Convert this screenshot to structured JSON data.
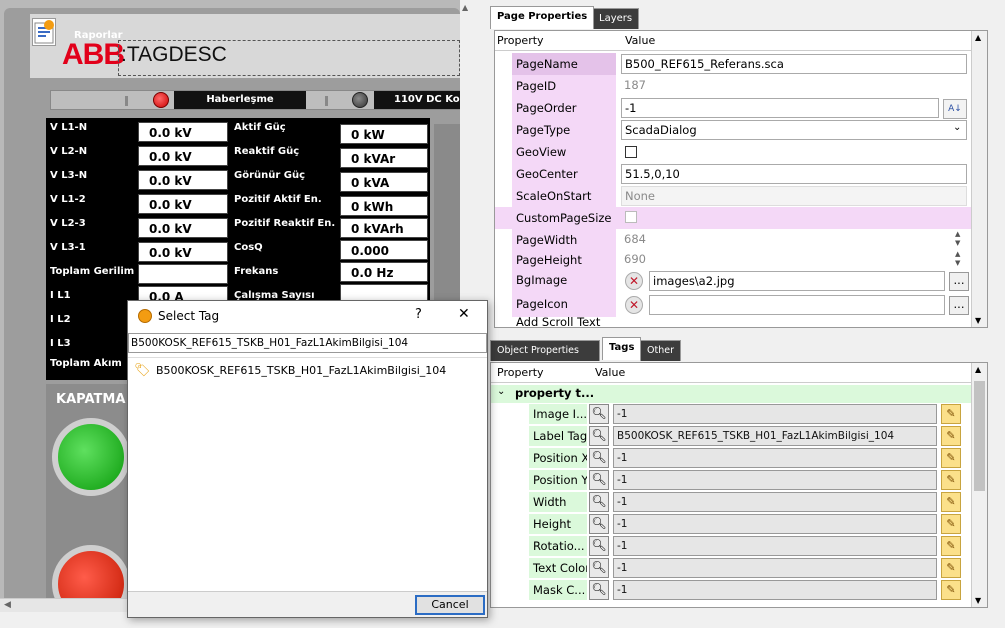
{
  "left_panel": {
    "report_label": "Raporlar",
    "logo_text": "ABB",
    "tag_description": ":TAGDESC",
    "status": {
      "comm_label": "Haberleşme",
      "dc_label": "110V DC Ko"
    },
    "measurements_left": [
      {
        "label": "V L1-N",
        "value": "0.0 kV"
      },
      {
        "label": "V L2-N",
        "value": "0.0 kV"
      },
      {
        "label": "V L3-N",
        "value": "0.0 kV"
      },
      {
        "label": "V L1-2",
        "value": "0.0 kV"
      },
      {
        "label": "V L2-3",
        "value": "0.0 kV"
      },
      {
        "label": "V L3-1",
        "value": "0.0 kV"
      },
      {
        "label": "Toplam Gerilim",
        "value": ""
      },
      {
        "label": "I L1",
        "value": "0.0 A"
      },
      {
        "label": "I L2",
        "value": ""
      },
      {
        "label": "I L3",
        "value": ""
      },
      {
        "label": "Toplam Akım",
        "value": ""
      }
    ],
    "measurements_right": [
      {
        "label": "Aktif Güç",
        "value": "0 kW"
      },
      {
        "label": "Reaktif Güç",
        "value": "0 kVAr"
      },
      {
        "label": "Görünür Güç",
        "value": "0 kVA"
      },
      {
        "label": "Pozitif Aktif En.",
        "value": "0 kWh"
      },
      {
        "label": "Pozitif Reaktif En.",
        "value": "0 kVArh"
      },
      {
        "label": "CosQ",
        "value": "0.000"
      },
      {
        "label": "Frekans",
        "value": "0.0 Hz"
      },
      {
        "label": "Çalışma Sayısı",
        "value": ""
      }
    ],
    "close_label": "KAPATMA"
  },
  "page_properties": {
    "tabs": [
      "Page Properties",
      "Layers"
    ],
    "header": {
      "property": "Property",
      "value": "Value"
    },
    "rows": [
      {
        "name": "PageName",
        "value": "B500_REF615_Referans.sca"
      },
      {
        "name": "PageID",
        "value": "187"
      },
      {
        "name": "PageOrder",
        "value": "-1"
      },
      {
        "name": "PageType",
        "value": "ScadaDialog"
      },
      {
        "name": "GeoView",
        "value": ""
      },
      {
        "name": "GeoCenter",
        "value": "51.5,0,10"
      },
      {
        "name": "ScaleOnStart",
        "value": "None"
      },
      {
        "name": "CustomPageSize",
        "value": ""
      },
      {
        "name": "PageWidth",
        "value": "684"
      },
      {
        "name": "PageHeight",
        "value": "690"
      },
      {
        "name": "BgImage",
        "value": "images\\a2.jpg"
      },
      {
        "name": "PageIcon",
        "value": ""
      },
      {
        "name": "Add Scroll Text",
        "value": ""
      }
    ]
  },
  "object_panel": {
    "tabs": [
      "Object Properties",
      "Tags",
      "Other"
    ],
    "header": {
      "property": "Property",
      "value": "Value"
    },
    "group_label": "property t...",
    "rows": [
      {
        "name": "Image I...",
        "value": "-1"
      },
      {
        "name": "Label Tag",
        "value": "B500KOSK_REF615_TSKB_H01_FazL1AkimBilgisi_104"
      },
      {
        "name": "Position X",
        "value": "-1"
      },
      {
        "name": "Position Y",
        "value": "-1"
      },
      {
        "name": "Width",
        "value": "-1"
      },
      {
        "name": "Height",
        "value": "-1"
      },
      {
        "name": "Rotatio...",
        "value": "-1"
      },
      {
        "name": "Text Color",
        "value": "-1"
      },
      {
        "name": "Mask C...",
        "value": "-1"
      }
    ]
  },
  "dialog": {
    "title": "Select Tag",
    "help": "?",
    "close": "✕",
    "search_value": "B500KOSK_REF615_TSKB_H01_FazL1AkimBilgisi_104",
    "results": [
      "B500KOSK_REF615_TSKB_H01_FazL1AkimBilgisi_104"
    ],
    "cancel_label": "Cancel"
  },
  "colors": {
    "prop_name_bg": "#f4d8f7",
    "tag_name_bg": "#dbf9db",
    "abb_red": "#e2001a"
  }
}
